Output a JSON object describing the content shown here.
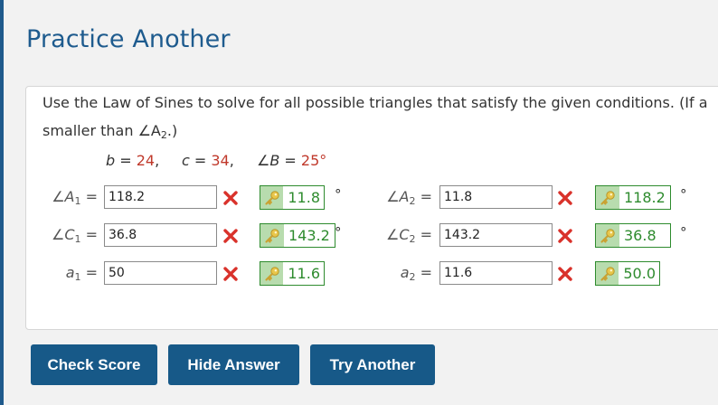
{
  "title": "Practice Another",
  "instructions": {
    "line1": "Use the Law of Sines to solve for all possible triangles that satisfy the given conditions. (If a",
    "line2_pre": "smaller than ∠A",
    "line2_sub": "2",
    "line2_post": ".)"
  },
  "given": {
    "b_label": "b",
    "b_value": "24",
    "c_label": "c",
    "c_value": "34",
    "B_label": "∠B",
    "B_value": "25°"
  },
  "rows": [
    {
      "left_label": "∠A",
      "left_sub": "1",
      "left_value": "118.2",
      "left_answer": "11.8",
      "left_unit": "°",
      "right_label": "∠A",
      "right_sub": "2",
      "right_value": "11.8",
      "right_answer": "118.2",
      "right_unit": "°"
    },
    {
      "left_label": "∠C",
      "left_sub": "1",
      "left_value": "36.8",
      "left_answer": "143.2",
      "left_unit": "°",
      "right_label": "∠C",
      "right_sub": "2",
      "right_value": "143.2",
      "right_answer": "36.8",
      "right_unit": "°"
    },
    {
      "left_label": "a",
      "left_sub": "1",
      "left_value": "50",
      "left_answer": "11.6",
      "left_unit": "",
      "right_label": "a",
      "right_sub": "2",
      "right_value": "11.6",
      "right_answer": "50.0",
      "right_unit": ""
    }
  ],
  "buttons": {
    "check": "Check Score",
    "hide": "Hide Answer",
    "try": "Try Another"
  },
  "colors": {
    "brand": "#175988",
    "title": "#1e5b8e",
    "incorrect": "#d9322b",
    "correct": "#2e8b2e",
    "given_value": "#c0392b"
  }
}
